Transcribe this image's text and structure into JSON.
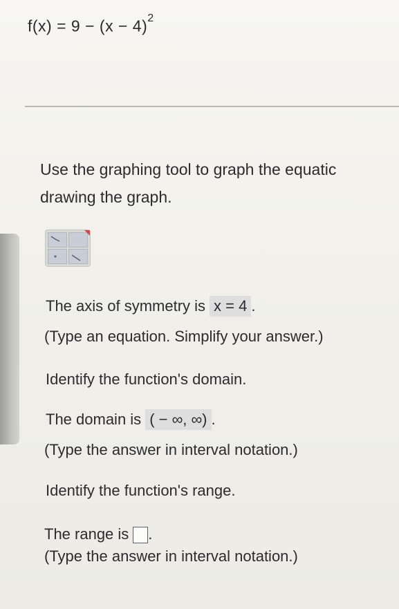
{
  "formula": {
    "text": "f(x) = 9 − (x − 4)",
    "exponent": "2"
  },
  "instructions": {
    "line1": "Use the graphing tool to graph the equatic",
    "line2": "drawing the graph."
  },
  "axis": {
    "prompt": "The axis of symmetry is",
    "answer": "x = 4",
    "suffix": ".",
    "hint": "(Type an equation. Simplify your answer.)"
  },
  "domain": {
    "heading": "Identify the function's domain.",
    "prompt": "The domain is",
    "answer": "( − ∞, ∞)",
    "suffix": ".",
    "hint": "(Type the answer in interval notation.)"
  },
  "range": {
    "heading": "Identify the function's range.",
    "prompt": "The range is",
    "suffix": ".",
    "hint": "(Type the answer in interval notation.)"
  }
}
